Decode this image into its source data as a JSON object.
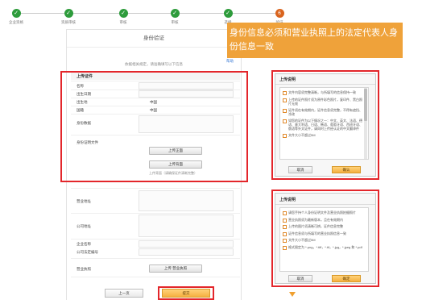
{
  "steps": [
    {
      "label": "企业资格",
      "state": "done"
    },
    {
      "label": "资质审核",
      "state": "done"
    },
    {
      "label": "审核",
      "state": "done"
    },
    {
      "label": "审核",
      "state": "done"
    },
    {
      "label": "选择",
      "state": "done"
    },
    {
      "label": "验证",
      "state": "current"
    }
  ],
  "step_marks": {
    "done": "✓",
    "current": "6"
  },
  "callout": "身份信息必须和营业执照上的法定代表人身份信息一致",
  "form": {
    "title": "身份验证",
    "notice": "依据相关规定，请准确填写以下信息",
    "help": "帮助",
    "section_title": "上传证件",
    "fields": [
      {
        "label": "名称"
      },
      {
        "label": "出生日期"
      },
      {
        "label": "出生地",
        "value": "中国"
      },
      {
        "label": "国籍",
        "value": "中国"
      },
      {
        "label": "身份数据"
      }
    ],
    "id_doc": {
      "label": "身份证明文件",
      "front_button": "上传正面",
      "back_button": "上传背面",
      "note": "上传背面（请确保证件清晰完整）"
    },
    "company_fields": [
      {
        "label": "营业地址"
      },
      {
        "label": "公司地址"
      },
      {
        "label": "企业名称"
      },
      {
        "label": "公司法定编号"
      }
    ],
    "license": {
      "label": "营业执照",
      "button": "上传 营业执照"
    }
  },
  "actions": {
    "prev": "上一页",
    "submit": "提交"
  },
  "dialogs": [
    {
      "title": "上传说明",
      "items": [
        "文件内容须完整清晰，与所填写的信息保持一致",
        "上传的证件照片须为原件彩色照片，复印件、黑白照片无效",
        "证件须在有效期内，证件信息须完整，不得有遮挡、涂改",
        "如您的证件为以下情况之一：中文、英文、法语、德语、意大利语、日语、韩语、葡萄牙语、西班牙语、俄语等外文证件，请同时上传经认证的中文翻译件",
        "文件大小不超过5M"
      ],
      "cancel": "取消",
      "confirm": "确认"
    },
    {
      "title": "上传说明",
      "items": [
        "请您手持个人身份证明文件及营业执照拍摄照片",
        "营业执照须为最新版本，且在有效期内",
        "上传的图片须清晰可辨，证件信息完整",
        "证件信息须与所填写的营业执照信息一致",
        "文件大小不超过5M",
        "格式限定为 *.png，*.tiff，*.tif，*.jpg，*.jpeg 和 *.pdf"
      ],
      "cancel": "取消",
      "confirm": "确定"
    }
  ],
  "colors": {
    "step_done": "#2e9c3c",
    "step_current": "#d9641e",
    "callout": "#efa23a",
    "highlight_border": "#e3262b",
    "primary_button": "#f5b040"
  }
}
